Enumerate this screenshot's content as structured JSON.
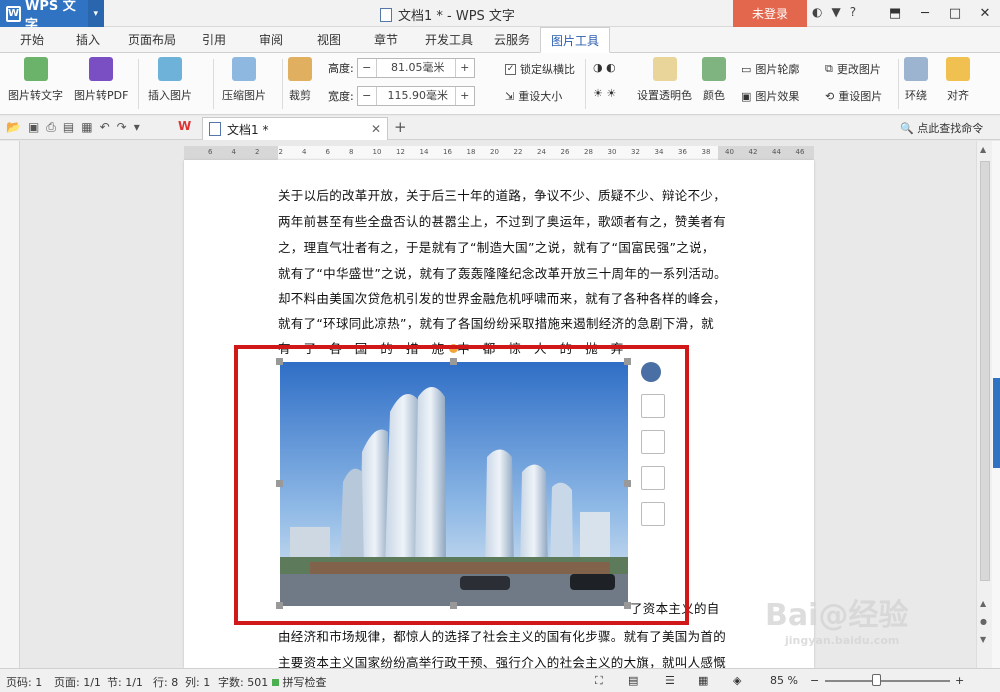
{
  "titlebar": {
    "app_name": "WPS 文字",
    "doc_title": "文档1 * - WPS 文字",
    "login": "未登录"
  },
  "menu": {
    "tabs": [
      "开始",
      "插入",
      "页面布局",
      "引用",
      "审阅",
      "视图",
      "章节",
      "开发工具",
      "云服务",
      "图片工具"
    ],
    "active": "图片工具"
  },
  "ribbon": {
    "img_to_text": "图片转文字",
    "img_to_pdf": "图片转PDF",
    "insert_image": "插入图片",
    "compress": "压缩图片",
    "crop": "裁剪",
    "height_label": "高度:",
    "height_value": "81.05毫米",
    "width_label": "宽度:",
    "width_value": "115.90毫米",
    "lock_ratio": "锁定纵横比",
    "reset_size": "重设大小",
    "set_transparent": "设置透明色",
    "color": "颜色",
    "outline": "图片轮廓",
    "effects": "图片效果",
    "change_image": "更改图片",
    "reset_image": "重设图片",
    "wrap": "环绕",
    "align": "对齐"
  },
  "quickbar": {
    "doc_tab": "文档1 *",
    "find_command": "点此查找命令"
  },
  "ruler": {
    "ticks": [
      "6",
      "4",
      "2",
      "2",
      "4",
      "6",
      "8",
      "10",
      "12",
      "14",
      "16",
      "18",
      "20",
      "22",
      "24",
      "26",
      "28",
      "30",
      "32",
      "34",
      "36",
      "38",
      "40",
      "42",
      "44",
      "46"
    ]
  },
  "document": {
    "lines": [
      "关于以后的改革开放，关于后三十年的道路，争议不少、质疑不少、辩论不少，",
      "两年前甚至有些全盘否认的甚嚣尘上，不过到了奥运年，歌颂者有之，赞美者有",
      "之，理直气壮者有之，于是就有了“制造大国”之说，就有了“国富民强”之说，",
      "就有了“中华盛世”之说，就有了轰轰隆隆纪念改革开放三十周年的一系列活动。",
      "却不料由美国次贷危机引发的世界金融危机呼啸而来，就有了各种各样的峰会，",
      "就有了“环球同此凉热”，就有了各国纷纷采取措施来遏制经济的急剧下滑，就",
      "有　了　各　国　的　措　施　中　都　惊　人　的　抛　弃"
    ],
    "after_image_fragment": "了资本主义的自",
    "lines_after": [
      "由经济和市场规律，都惊人的选择了社会主义的国有化步骤。就有了美国为首的",
      "主要资本主义国家纷纷高举行政干预、强行介入的社会主义的大旗，就叫人感慨"
    ]
  },
  "status": {
    "page_code": "页码: 1",
    "page": "页面: 1/1",
    "section": "节: 1/1",
    "row": "行: 8",
    "col": "列: 1",
    "word_count": "字数: 501",
    "spell_check": "拼写检查",
    "zoom": "85 %"
  },
  "watermark": {
    "main": "Bai@经验",
    "sub": "jingyan.baidu.com"
  },
  "colors": {
    "app_blue": "#2f73c2",
    "login_orange": "#e2674d",
    "highlight_red": "#d01818"
  }
}
